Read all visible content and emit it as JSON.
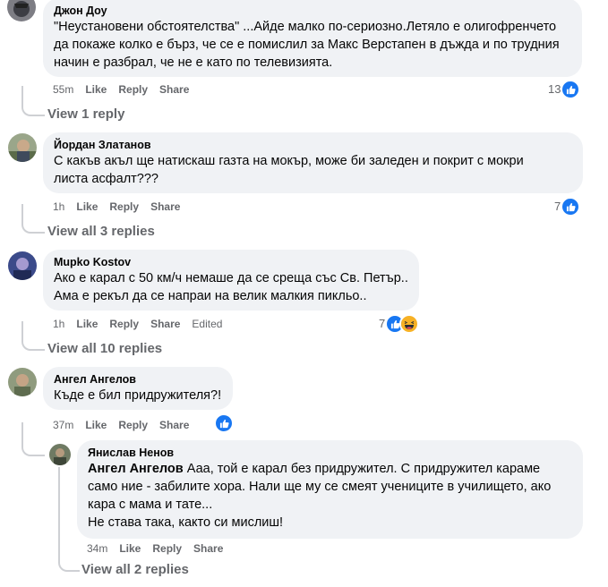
{
  "comments": [
    {
      "author": "Джон Доу",
      "text_lines": [
        "\"Неустановени обстоятелства\" ...Айде малко по-сериозно.Летяло е олигофренчето",
        "да покаже колко е бърз, че се е помислил за Макс Верстапен в дъжда и по трудния",
        "начин е разбрал, че не е като по телевизията."
      ],
      "time": "55m",
      "like": "Like",
      "reply": "Reply",
      "share": "Share",
      "reaction_count": "13",
      "replies_link": "View 1 reply"
    },
    {
      "author": "Йордан Златанов",
      "text_lines": [
        "С какъв акъл ще натискаш газта на мокър, може би заледен и покрит с мокри",
        "листа асфалт???"
      ],
      "time": "1h",
      "like": "Like",
      "reply": "Reply",
      "share": "Share",
      "reaction_count": "7",
      "replies_link": "View all 3 replies"
    },
    {
      "author": "Mupko Kostov",
      "text_lines": [
        "Ако е карал с 50 км/ч немаше да се среща със Св. Петър..",
        "Ама е рекъл да се напраи на велик малкия пикльо.."
      ],
      "time": "1h",
      "like": "Like",
      "reply": "Reply",
      "share": "Share",
      "edited": "Edited",
      "reaction_count": "7",
      "replies_link": "View all 10 replies"
    },
    {
      "author": "Ангел Ангелов",
      "text_lines": [
        "Къде е бил придружителя?!"
      ],
      "time": "37m",
      "like": "Like",
      "reply": "Reply",
      "share": "Share"
    }
  ],
  "reply": {
    "author": "Янислав Ненов",
    "mention": "Ангел Ангелов",
    "text_first": " Ааа, той е карал без придружител. С придружител караме",
    "text_lines": [
      "само ние - забилите хора. Нали ще му се смеят учениците в училището, ако",
      "кара с мама и тате...",
      "Не става така, както си мислиш!"
    ],
    "time": "34m",
    "like": "Like",
    "reply": "Reply",
    "share": "Share",
    "replies_link": "View all 2 replies"
  },
  "colors": {
    "bubble": "#f0f2f5",
    "secondary_text": "#65676b",
    "like_blue": "#1877f2",
    "thread_line": "#ced0d4"
  }
}
